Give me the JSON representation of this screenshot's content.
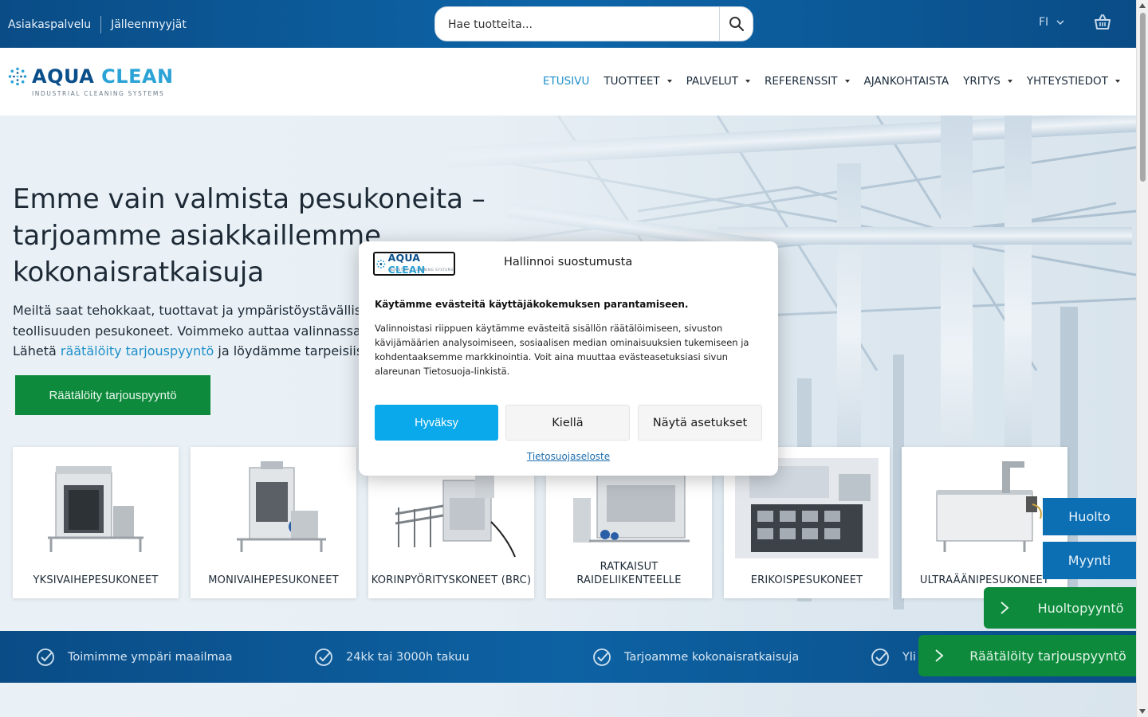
{
  "topbar": {
    "link_customer_service": "Asiakaspalvelu",
    "link_resellers": "Jälleenmyyjät",
    "search_placeholder": "Hae tuotteita...",
    "language": "FI"
  },
  "brand": {
    "name_part1": "AQUA",
    "name_part2": "CLEAN",
    "tagline": "INDUSTRIAL CLEANING SYSTEMS"
  },
  "nav": [
    {
      "label": "ETUSIVU",
      "active": true,
      "has_dropdown": false
    },
    {
      "label": "TUOTTEET",
      "active": false,
      "has_dropdown": true
    },
    {
      "label": "PALVELUT",
      "active": false,
      "has_dropdown": true
    },
    {
      "label": "REFERENSSIT",
      "active": false,
      "has_dropdown": true
    },
    {
      "label": "AJANKOHTAISTA",
      "active": false,
      "has_dropdown": false
    },
    {
      "label": "YRITYS",
      "active": false,
      "has_dropdown": true
    },
    {
      "label": "YHTEYSTIEDOT",
      "active": false,
      "has_dropdown": true
    }
  ],
  "hero": {
    "heading": "Emme vain valmista pesukoneita – tarjoamme asiakkaillemme kokonaisratkaisuja",
    "lead_before": "Meiltä saat tehokkaat, tuottavat ja ympäristöystävälliset teollisuuden pesukoneet. Voimmeko auttaa valinnassa? Lähetä ",
    "lead_link": "räätälöity tarjouspyyntö",
    "lead_after": " ja löydämme tarpeisiisi sopivin ratkaisu!",
    "cta": "Räätälöity tarjouspyyntö"
  },
  "categories": [
    {
      "label": "YKSIVAIHEPESUKONEET"
    },
    {
      "label": "MONIVAIHEPESUKONEET"
    },
    {
      "label": "KORINPYÖRITYSKONEET (BRC)"
    },
    {
      "label": "RATKAISUT RAIDELIIKENTEELLE"
    },
    {
      "label": "ERIKOISPESUKONEET"
    },
    {
      "label": "ULTRAÄÄNIPESUKONEET"
    }
  ],
  "features": [
    {
      "label": "Toimimme ympäri maailmaa"
    },
    {
      "label": "24kk tai 3000h takuu"
    },
    {
      "label": "Tarjoamme kokonaisratkaisuja"
    },
    {
      "label": "Yli"
    }
  ],
  "side": {
    "service": "Huolto",
    "sales": "Myynti",
    "service_request": "Huoltopyyntö",
    "custom_quote": "Räätälöity tarjouspyyntö"
  },
  "consent": {
    "title": "Hallinnoi suostumusta",
    "heading": "Käytämme evästeitä käyttäjäkokemuksen parantamiseen.",
    "body": "Valinnoistasi riippuen käytämme evästeitä sisällön räätälöimiseen, sivuston kävijämäärien analysoimiseen, sosiaalisen median ominaisuuksien tukemiseen ja kohdentaaksemme markkinointia. Voit aina muuttaa evästeasetuksiasi sivun alareunan Tietosuoja-linkistä.",
    "accept": "Hyväksy",
    "deny": "Kiellä",
    "settings": "Näytä asetukset",
    "privacy_link": "Tietosuojaseloste"
  },
  "colors": {
    "primary_blue": "#0d62a3",
    "accent_cyan": "#0aa9eb",
    "green": "#0e8a3c"
  }
}
